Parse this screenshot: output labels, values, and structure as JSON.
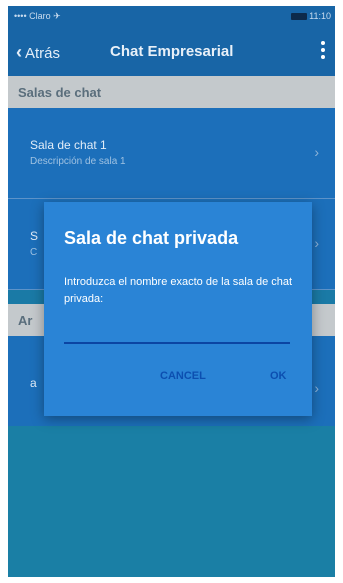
{
  "status_bar": {
    "carrier": "•••• Claro ✈",
    "time": "11:10"
  },
  "nav": {
    "back_label": "Atrás",
    "title": "Chat Empresarial"
  },
  "sections": [
    {
      "header": "Salas de chat"
    },
    {
      "header": "Ar"
    }
  ],
  "rooms": [
    {
      "name": "Sala de chat 1",
      "description": "Descripción de sala 1"
    },
    {
      "name": "S",
      "description": "C"
    },
    {
      "name": "a",
      "description": ""
    }
  ],
  "dialog": {
    "title": "Sala de chat privada",
    "message": "Introduzca el nombre exacto de la sala de chat privada:",
    "input_value": "",
    "cancel_label": "CANCEL",
    "ok_label": "OK"
  },
  "colors": {
    "nav_background": "#1865a6",
    "list_background": "#1c6fba",
    "dialog_background": "#2a84d6",
    "section_header": "#c4c9cc",
    "button_text": "#0c4fb0"
  }
}
